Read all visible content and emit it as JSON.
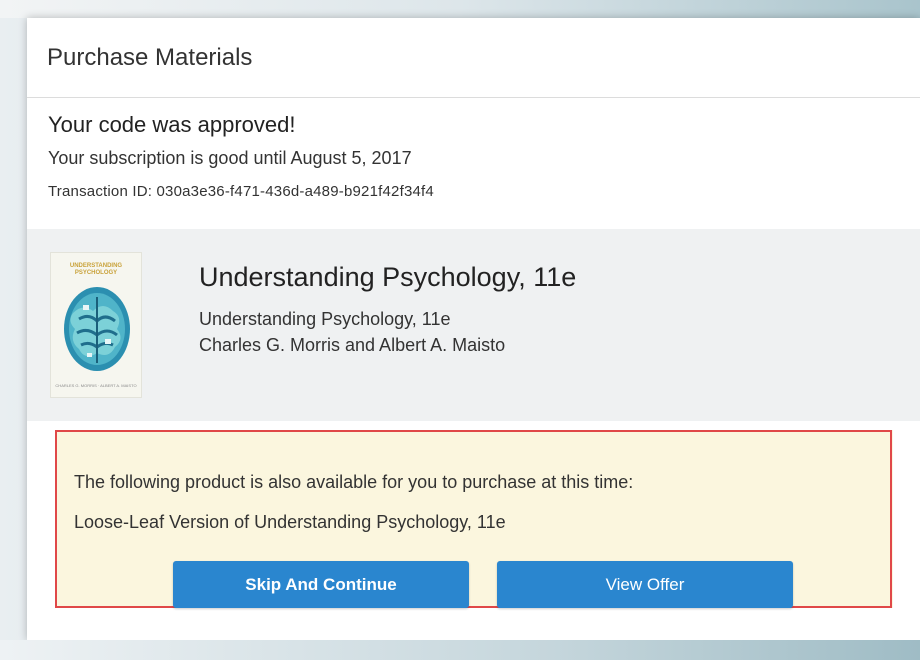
{
  "modal": {
    "title": "Purchase Materials"
  },
  "approval": {
    "heading": "Your code was approved!",
    "subscription": "Your subscription is good until August 5, 2017",
    "transaction": "Transaction ID: 030a3e36-f471-436d-a489-b921f42f34f4"
  },
  "product": {
    "cover_title_line1": "UNDERSTANDING",
    "cover_title_line2": "PSYCHOLOGY",
    "cover_authors": "CHARLES G. MORRIS · ALBERT A. MAISTO",
    "title": "Understanding Psychology, 11e",
    "subtitle": "Understanding Psychology, 11e",
    "authors": "Charles G. Morris and Albert A. Maisto"
  },
  "offer": {
    "text": "The following product is also available for you to purchase at this time:",
    "product_name": "Loose-Leaf Version of Understanding Psychology, 11e",
    "skip_label": "Skip And Continue",
    "view_label": "View Offer"
  },
  "colors": {
    "button": "#2a86cf",
    "offer_background": "#fbf6de",
    "highlight_border": "#e04848",
    "product_panel": "#eff1f2"
  }
}
